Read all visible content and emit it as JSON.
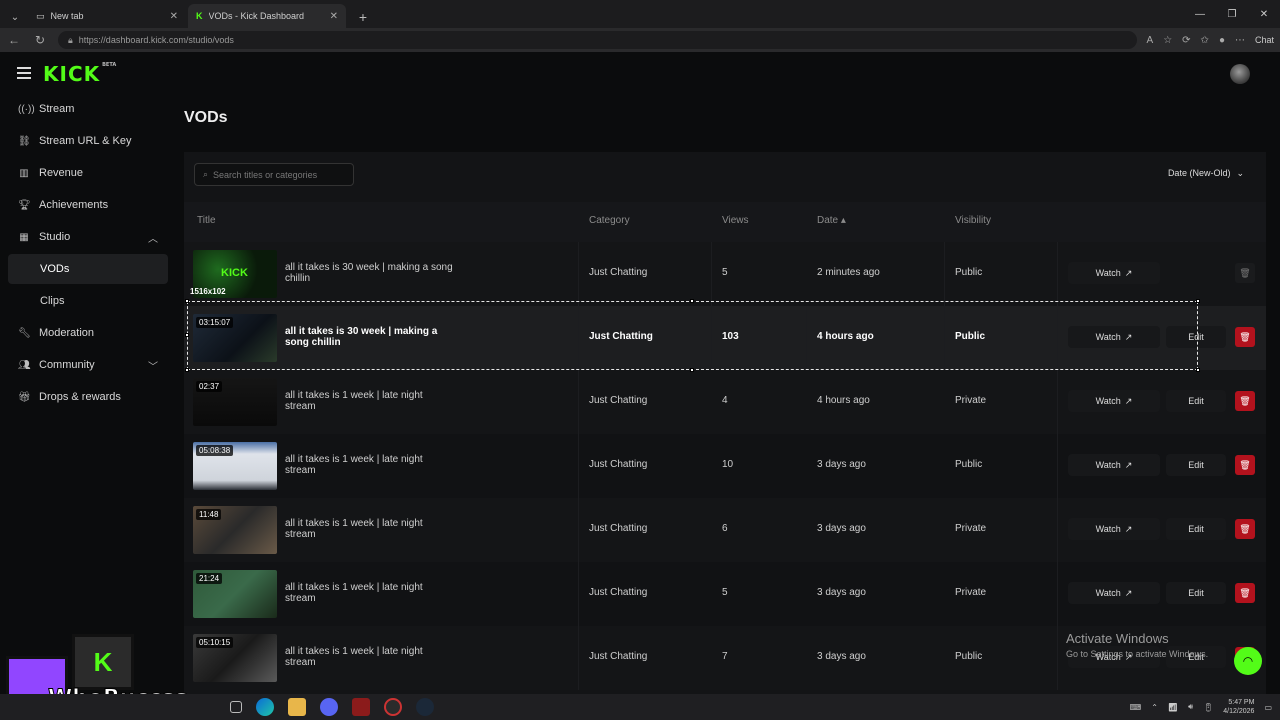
{
  "browser": {
    "tabs": [
      {
        "title": "New tab"
      },
      {
        "title": "VODs - Kick Dashboard"
      }
    ],
    "url": "https://dashboard.kick.com/studio/vods",
    "chat_label": "Chat"
  },
  "app": {
    "logo": "KICK",
    "logo_badge": "BETA",
    "nav": [
      {
        "label": "Stream",
        "icon": "broadcast-icon"
      },
      {
        "label": "Stream URL & Key",
        "icon": "link-icon"
      },
      {
        "label": "Revenue",
        "icon": "chart-icon"
      },
      {
        "label": "Achievements",
        "icon": "trophy-icon"
      },
      {
        "label": "Studio",
        "icon": "studio-icon"
      },
      {
        "label": "VODs"
      },
      {
        "label": "Clips"
      },
      {
        "label": "Moderation",
        "icon": "wrench-icon"
      },
      {
        "label": "Community",
        "icon": "community-icon"
      },
      {
        "label": "Drops & rewards",
        "icon": "gift-icon"
      }
    ]
  },
  "page": {
    "title": "VODs",
    "search_placeholder": "Search titles or categories",
    "sort_label": "Date (New-Old)",
    "columns": [
      "Title",
      "Category",
      "Views",
      "Date",
      "Visibility"
    ],
    "watch_label": "Watch",
    "edit_label": "Edit"
  },
  "selection": {
    "size_label": "1516x102"
  },
  "vods": [
    {
      "duration": "",
      "title": "all it takes is 30 week | making a song chillin",
      "category": "Just Chatting",
      "views": "5",
      "date": "2 minutes ago",
      "visibility": "Public"
    },
    {
      "duration": "03:15:07",
      "title": "all it takes is 30 week | making a song chillin",
      "category": "Just Chatting",
      "views": "103",
      "date": "4 hours ago",
      "visibility": "Public"
    },
    {
      "duration": "02:37",
      "title": "all it takes is 1 week | late night stream",
      "category": "Just Chatting",
      "views": "4",
      "date": "4 hours ago",
      "visibility": "Private"
    },
    {
      "duration": "05:08:38",
      "title": "all it takes is 1 week | late night stream",
      "category": "Just Chatting",
      "views": "10",
      "date": "3 days ago",
      "visibility": "Public"
    },
    {
      "duration": "11:48",
      "title": "all it takes is 1 week | late night stream",
      "category": "Just Chatting",
      "views": "6",
      "date": "3 days ago",
      "visibility": "Private"
    },
    {
      "duration": "21:24",
      "title": "all it takes is 1 week | late night stream",
      "category": "Just Chatting",
      "views": "5",
      "date": "3 days ago",
      "visibility": "Private"
    },
    {
      "duration": "05:10:15",
      "title": "all it takes is 1 week | late night stream",
      "category": "Just Chatting",
      "views": "7",
      "date": "3 days ago",
      "visibility": "Public"
    }
  ],
  "windows": {
    "activate_title": "Activate Windows",
    "activate_sub": "Go to Settings to activate Windows.",
    "time": "5:47 PM",
    "date": "4/12/2026"
  },
  "overlay": {
    "streamer_name": "WhoBuccss"
  },
  "colors": {
    "accent": "#53fc18",
    "danger": "#b3121d",
    "background": "#0b0c0d"
  }
}
